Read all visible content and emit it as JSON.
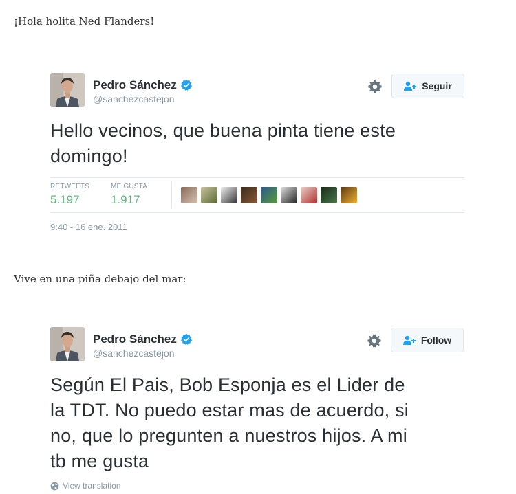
{
  "captions": {
    "first": "¡Hola holita Ned Flanders!",
    "second": "Vive en una piña debajo del mar:"
  },
  "tweet1": {
    "name": "Pedro Sánchez",
    "handle": "@sanchezcastejon",
    "follow_label": "Seguir",
    "text_lines": [
      "Hello vecinos, que buena pinta tiene este",
      "domingo!"
    ],
    "retweets_label": "RETWEETS",
    "retweets_value": "5.197",
    "likes_label": "ME GUSTA",
    "likes_value": "1.917",
    "timestamp": "9:40 - 16 ene. 2011"
  },
  "tweet2": {
    "name": "Pedro Sánchez",
    "handle": "@sanchezcastejon",
    "follow_label": "Follow",
    "text_lines": [
      "Según El Pais, Bob Esponja es el Lider de",
      "la TDT. No puedo estar mas de acuerdo, si",
      "no, que lo pregunten a nuestros hijos. A mi",
      "tb me gusta"
    ],
    "translation_label": "View translation"
  },
  "colors": {
    "stat_value": "#66b47e",
    "muted": "#8899a6",
    "verified": "#1da1f2"
  },
  "icons": [
    "verified-badge-icon",
    "gear-icon",
    "add-user-icon",
    "globe-icon"
  ]
}
